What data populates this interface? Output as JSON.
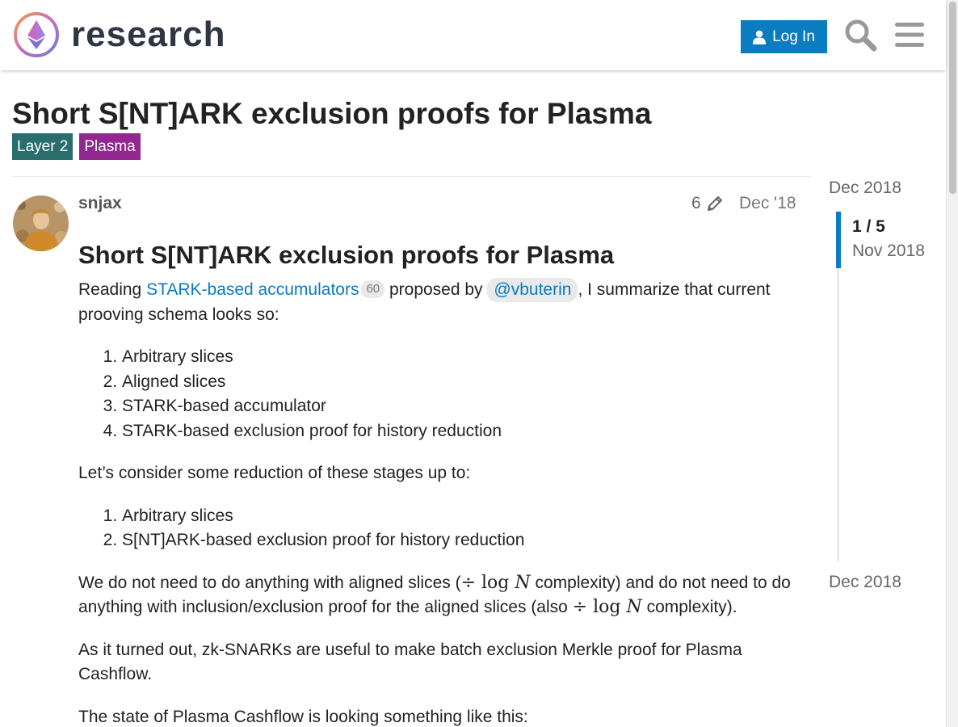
{
  "header": {
    "logo_text": "research",
    "login_label": "Log In",
    "icons": [
      "user-icon",
      "search-icon",
      "hamburger-menu-icon"
    ]
  },
  "topic": {
    "title": "Short S[NT]ARK exclusion proofs for Plasma",
    "tags": [
      {
        "label": "Layer 2",
        "color": "#2a6d6d"
      },
      {
        "label": "Plasma",
        "color": "#92278f"
      }
    ]
  },
  "post": {
    "username": "snjax",
    "edit_count": "6",
    "date": "Dec '18",
    "heading": "Short S[NT]ARK exclusion proofs for Plasma",
    "p1": {
      "before": "Reading ",
      "link": "STARK-based accumulators",
      "link_clicks": "60",
      "middle": " proposed by ",
      "mention": "@vbuterin",
      "after": ", I summarize that current prooving schema looks so:"
    },
    "list1": [
      "Arbitrary slices",
      "Aligned slices",
      "STARK-based accumulator",
      "STARK-based exclusion proof for history reduction"
    ],
    "p2": "Let’s consider some reduction of these stages up to:",
    "list2": [
      "Arbitrary slices",
      "S[NT]ARK-based exclusion proof for history reduction"
    ],
    "p3": {
      "part1": "We do not need to do anything with aligned slices (",
      "math1_op": "÷",
      "math1_fn": "log",
      "math1_var": "N",
      "part2": " complexity) and do not need to do anything with inclusion/exclusion proof for the aligned slices (also ",
      "math2_op": "÷",
      "math2_fn": "log",
      "math2_var": "N",
      "part3": " complexity)."
    },
    "p4": "As it turned out, zk-SNARKs are useful to make batch exclusion Merkle proof for Plasma Cashflow.",
    "p5": "The state of Plasma Cashflow is looking something like this:"
  },
  "timeline": {
    "top_date": "Dec 2018",
    "count": "1 / 5",
    "current_date": "Nov 2018",
    "bottom_date": "Dec 2018"
  },
  "colors": {
    "accent": "#0a7cbf",
    "tag_layer2": "#2a6d6d",
    "tag_plasma": "#92278f"
  }
}
